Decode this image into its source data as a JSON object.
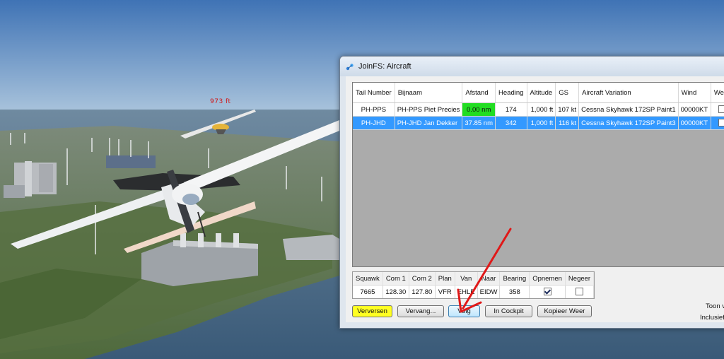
{
  "scene": {
    "altitude_label": "973 ft"
  },
  "window": {
    "title": "JoinFS: Aircraft",
    "app_icon": "joinfs-app-icon"
  },
  "aircraft_table": {
    "columns": [
      "Tail Number",
      "Bijnaam",
      "Afstand",
      "Heading",
      "Altitude",
      "GS",
      "Aircraft Variation",
      "Wind",
      "Weer"
    ],
    "rows": [
      {
        "tail": "PH-PPS",
        "nickname": "PH-PPS  Piet Precies",
        "distance": "0.00 nm",
        "heading": "174",
        "altitude": "1,000 ft",
        "gs": "107 kt",
        "variation": "Cessna Skyhawk 172SP Paint1",
        "wind": "00000KT",
        "weather_checked": false,
        "selected": false
      },
      {
        "tail": "PH-JHD",
        "nickname": "PH-JHD  Jan Dekker",
        "distance": "37.85 nm",
        "heading": "342",
        "altitude": "1,000 ft",
        "gs": "116 kt",
        "variation": "Cessna Skyhawk 172SP Paint3",
        "wind": "00000KT",
        "weather_checked": false,
        "selected": true
      }
    ]
  },
  "info_table": {
    "columns": [
      "Squawk",
      "Com 1",
      "Com 2",
      "Plan",
      "Van",
      "Naar",
      "Bearing",
      "Opnemen",
      "Negeer"
    ],
    "values": {
      "squawk": "7665",
      "com1": "128.30",
      "com2": "127.80",
      "plan": "VFR",
      "van": "EHLE",
      "naar": "EIDW",
      "bearing": "358",
      "opnemen": true,
      "negeer": false
    }
  },
  "buttons": {
    "refresh": "Verversen",
    "replace": "Vervang...",
    "follow": "Volg",
    "in_cockpit": "In Cockpit",
    "copy_weather": "Kopieer Weer"
  },
  "side_options": {
    "show": "Toon v",
    "include": "Inclusief"
  },
  "colors": {
    "refresh_button": "#ffff22",
    "distance_highlight": "#22dd22",
    "selection": "#3399ff",
    "arrow": "#e01818"
  }
}
